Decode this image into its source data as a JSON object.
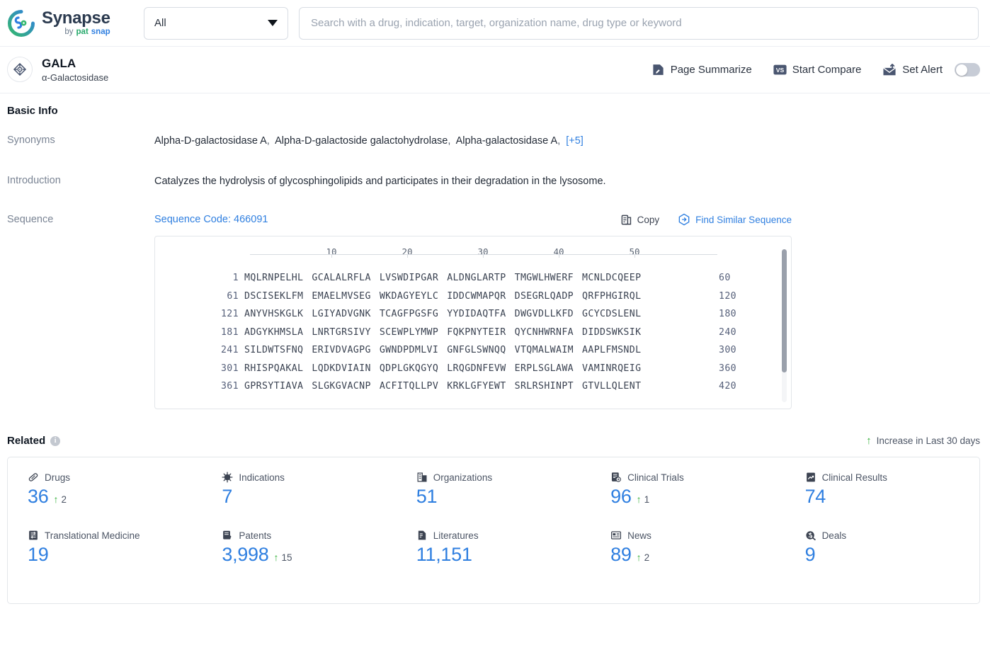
{
  "topbar": {
    "brand": {
      "name": "Synapse",
      "by": "by",
      "pat": "pat",
      "snap": "snap",
      "logo_icon": "synapse-logo-icon"
    },
    "scope_select": {
      "value": "All",
      "icon": "chevron-down-icon"
    },
    "search": {
      "value": "",
      "placeholder": "Search with a drug, indication, target, organization name, drug type or keyword"
    }
  },
  "entity": {
    "badge_icon": "target-diamond-icon",
    "title": "GALA",
    "subtitle": "α-Galactosidase",
    "actions": [
      {
        "label": "Page Summarize",
        "icon": "page-summarize-icon"
      },
      {
        "label": "Start Compare",
        "icon": "vs-compare-icon"
      },
      {
        "label": "Set Alert",
        "icon": "alert-mail-icon",
        "toggle_on": false
      }
    ]
  },
  "basic_info": {
    "title": "Basic Info",
    "synonyms": {
      "label": "Synonyms",
      "values": [
        "Alpha-D-galactosidase A",
        "Alpha-D-galactoside galactohydrolase",
        "Alpha-galactosidase A"
      ],
      "more": "[+5]"
    },
    "introduction": {
      "label": "Introduction",
      "text": "Catalyzes the hydrolysis of glycosphingolipids and participates in their degradation in the lysosome."
    },
    "sequence": {
      "label": "Sequence",
      "code_label": "Sequence Code: 466091",
      "copy_label": "Copy",
      "copy_icon": "copy-icon",
      "similar_label": "Find Similar Sequence",
      "similar_icon": "find-similar-sequence-icon",
      "ruler": [
        10,
        20,
        30,
        40,
        50
      ],
      "rows": [
        {
          "start": "1",
          "blocks": [
            "MQLRNPELHL",
            "GCALALRFLA",
            "LVSWDIPGAR",
            "ALDNGLARTP",
            "TMGWLHWERF",
            "MCNLDCQEEP"
          ],
          "end": "60"
        },
        {
          "start": "61",
          "blocks": [
            "DSCISEKLFM",
            "EMAELMVSEG",
            "WKDAGYEYLC",
            "IDDCWMAPQR",
            "DSEGRLQADP",
            "QRFPHGIRQL"
          ],
          "end": "120"
        },
        {
          "start": "121",
          "blocks": [
            "ANYVHSKGLK",
            "LGIYADVGNK",
            "TCAGFPGSFG",
            "YYDIDAQTFA",
            "DWGVDLLKFD",
            "GCYCDSLENL"
          ],
          "end": "180"
        },
        {
          "start": "181",
          "blocks": [
            "ADGYKHMSLA",
            "LNRTGRSIVY",
            "SCEWPLYMWP",
            "FQKPNYTEIR",
            "QYCNHWRNFA",
            "DIDDSWKSIK"
          ],
          "end": "240"
        },
        {
          "start": "241",
          "blocks": [
            "SILDWTSFNQ",
            "ERIVDVAGPG",
            "GWNDPDMLVI",
            "GNFGLSWNQQ",
            "VTQMALWAIM",
            "AAPLFMSNDL"
          ],
          "end": "300"
        },
        {
          "start": "301",
          "blocks": [
            "RHISPQAKAL",
            "LQDKDVIAIN",
            "QDPLGKQGYQ",
            "LRQGDNFEVW",
            "ERPLSGLAWA",
            "VAMINRQEIG"
          ],
          "end": "360"
        },
        {
          "start": "361",
          "blocks": [
            "GPRSYTIAVA",
            "SLGKGVACNP",
            "ACFITQLLPV",
            "KRKLGFYEWT",
            "SRLRSHINPT",
            "GTVLLQLENT"
          ],
          "end": "420"
        }
      ]
    }
  },
  "related": {
    "title": "Related",
    "info_icon": "info-icon",
    "legend_label": "Increase in Last 30 days",
    "legend_icon": "up-arrow-icon",
    "stats": [
      {
        "label": "Drugs",
        "icon": "pill-icon",
        "value": "36",
        "delta": "2"
      },
      {
        "label": "Indications",
        "icon": "virus-icon",
        "value": "7",
        "delta": ""
      },
      {
        "label": "Organizations",
        "icon": "building-icon",
        "value": "51",
        "delta": ""
      },
      {
        "label": "Clinical Trials",
        "icon": "clinical-trial-icon",
        "value": "96",
        "delta": "1"
      },
      {
        "label": "Clinical Results",
        "icon": "clinical-result-icon",
        "value": "74",
        "delta": ""
      },
      {
        "label": "Translational Medicine",
        "icon": "translational-icon",
        "value": "19",
        "delta": ""
      },
      {
        "label": "Patents",
        "icon": "patent-icon",
        "value": "3,998",
        "delta": "15"
      },
      {
        "label": "Literatures",
        "icon": "literature-icon",
        "value": "11,151",
        "delta": ""
      },
      {
        "label": "News",
        "icon": "news-icon",
        "value": "89",
        "delta": "2"
      },
      {
        "label": "Deals",
        "icon": "deals-icon",
        "value": "9",
        "delta": ""
      }
    ]
  },
  "colors": {
    "accent_blue": "#2f7fe0",
    "green": "#35b03a",
    "text_dark": "#0f1722",
    "muted": "#7a8494"
  }
}
